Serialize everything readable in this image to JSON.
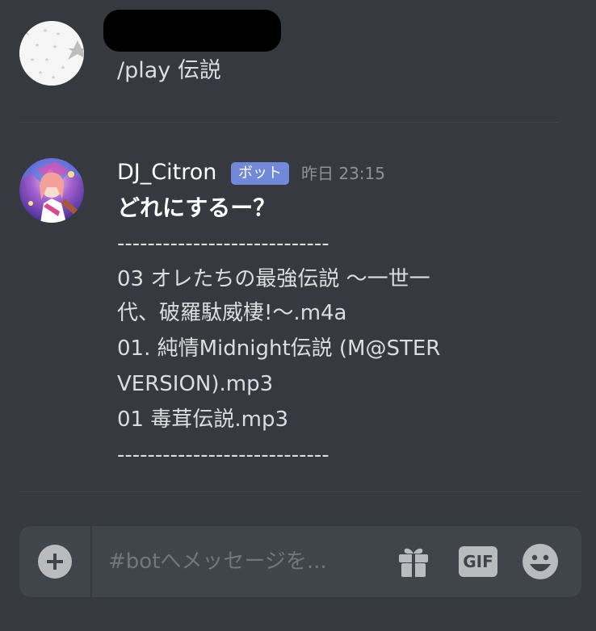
{
  "messages": [
    {
      "author": "",
      "content": "/play 伝説"
    },
    {
      "author": "DJ_Citron",
      "bot_tag": "ボット",
      "timestamp": "昨日 23:15",
      "title": "どれにするー？",
      "lines": [
        "----------------------------",
        "03 オレたちの最強伝説 〜一世一",
        "代、破羅駄威棲!〜.m4a",
        "01. 純情Midnight伝説 (M@STER",
        "VERSION).mp3",
        "01 毒茸伝説.mp3",
        "----------------------------"
      ]
    }
  ],
  "composer": {
    "placeholder": "#botへメッセージを..."
  },
  "icons": {
    "attach": "plus-circle-icon",
    "gift": "gift-icon",
    "gif": "GIF",
    "emoji": "emoji-smile-icon"
  },
  "colors": {
    "background": "#36393f",
    "bot_tag": "#7289da",
    "composer": "#40444b",
    "timestamp": "#8e9297"
  }
}
